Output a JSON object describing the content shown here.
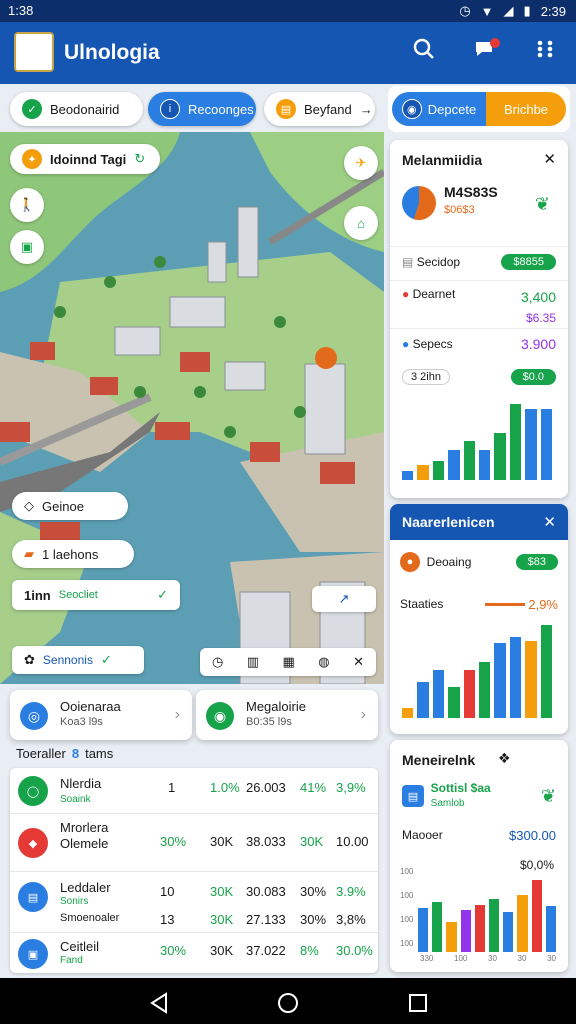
{
  "status": {
    "time": "1:38",
    "right_time": "2:39"
  },
  "app": {
    "title": "Ulnologia"
  },
  "filters": [
    {
      "label": "Beodonairid",
      "icon": "check-icon"
    },
    {
      "label": "Recoonges",
      "icon": "info-icon"
    },
    {
      "label": "Beyfand",
      "arrow": "→"
    }
  ],
  "toggle": {
    "left": "Depcete",
    "right": "Brichbe"
  },
  "map": {
    "top_chip": "Idoinnd Tagi",
    "chips": [
      {
        "label": "Geinoe"
      },
      {
        "label": "1 laehons"
      },
      {
        "label": "Seocliet",
        "prefix": "1inn"
      },
      {
        "label": "Sennonis"
      }
    ]
  },
  "panel1": {
    "title": "Melanmiidia",
    "stat_value": "M4S83S",
    "stat_sub": "$06$3",
    "rows": [
      {
        "label": "Secidop",
        "value": "$8855"
      },
      {
        "label": "Dearnet",
        "value": "3,400",
        "value2": "$6.35"
      },
      {
        "label": "Sepecs",
        "value": "3.900"
      },
      {
        "label": "3 2ihn",
        "value": "$0.0"
      }
    ],
    "bars": [
      0.1,
      0.18,
      0.22,
      0.35,
      0.45,
      0.35,
      0.55,
      0.88,
      0.82,
      0.82
    ]
  },
  "panel2": {
    "title": "Naarerlenicen",
    "row_label": "Deoaing",
    "row_value": "$83",
    "stat_label": "Staaties",
    "stat_value": "2,9%",
    "bars": [
      0.1,
      0.38,
      0.5,
      0.32,
      0.5,
      0.58,
      0.78,
      0.84,
      0.8,
      0.97
    ]
  },
  "panel3": {
    "title": "Meneirelnk",
    "item_label": "Sottisl $aa",
    "item_sub": "Samlob",
    "row_label": "Maooer",
    "row_value": "$300.00",
    "row_value2": "$0,0%",
    "yticks": [
      "100",
      "100",
      "100",
      "100"
    ],
    "xticks": [
      "330",
      "100",
      "30",
      "30",
      "30"
    ],
    "bars": [
      0.58,
      0.66,
      0.4,
      0.55,
      0.62,
      0.7,
      0.52,
      0.75,
      0.95,
      0.6
    ]
  },
  "cards": [
    {
      "title": "Ooienaraa",
      "sub": "Koa3 l9s"
    },
    {
      "title": "Megaloirie",
      "sub": "B0:35 l9s"
    }
  ],
  "section": {
    "title": "Toeraller",
    "badge": "8",
    "suffix": "tams"
  },
  "table": [
    {
      "name": "Nlerdia",
      "sub": "Soaink",
      "c1": "1",
      "c2": "1.0%",
      "c3": "26.003",
      "c4": "41%",
      "c5": "3,9%"
    },
    {
      "name": "Mrorlera",
      "sub": "Olemele",
      "c1": "30%",
      "c2": "30K",
      "c3": "38.033",
      "c4": "30K",
      "c5": "10.00"
    },
    {
      "name": "Leddaler",
      "sub": "Sonirs",
      "c1": "10",
      "c2": "30K",
      "c3": "30.083",
      "c4": "30%",
      "c5": "3.9%"
    },
    {
      "name": "Smoenoaler",
      "sub": "",
      "c1": "13",
      "c2": "30K",
      "c3": "27.133",
      "c4": "30%",
      "c5": "3,8%"
    },
    {
      "name": "Ceitleil",
      "sub": "Fand",
      "c1": "30%",
      "c2": "30K",
      "c3": "37.022",
      "c4": "8%",
      "c5": "30.0%"
    }
  ],
  "colors": {
    "primary": "#1556b2",
    "green": "#16a34a",
    "orange": "#f59e0b"
  }
}
